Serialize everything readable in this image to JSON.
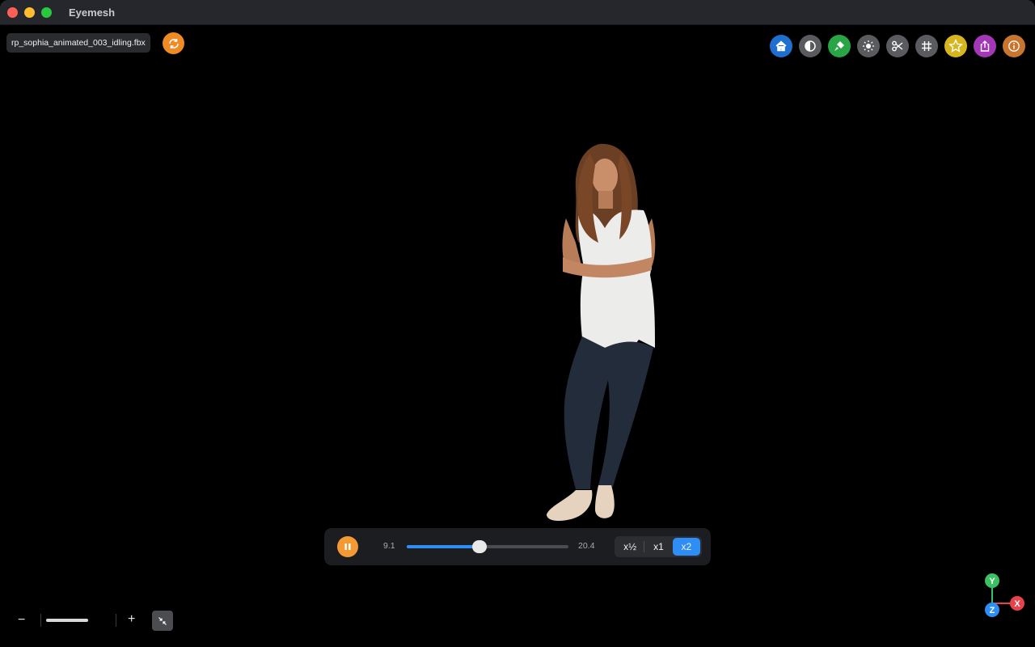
{
  "window": {
    "title": "Eyemesh"
  },
  "file": {
    "name": "rp_sophia_animated_003_idling.fbx"
  },
  "toolbar": {
    "items": [
      {
        "name": "home",
        "icon": "home-icon",
        "color": "#1f6fd1"
      },
      {
        "name": "contrast",
        "icon": "contrast-icon",
        "color": "#5a5b5e"
      },
      {
        "name": "paint",
        "icon": "paint-icon",
        "color": "#2aa545"
      },
      {
        "name": "light",
        "icon": "sun-icon",
        "color": "#5a5b5e"
      },
      {
        "name": "cut",
        "icon": "scissors-icon",
        "color": "#5a5b5e"
      },
      {
        "name": "grid",
        "icon": "grid-icon",
        "color": "#5a5b5e"
      },
      {
        "name": "favorite",
        "icon": "star-icon",
        "color": "#d7b61d"
      },
      {
        "name": "share",
        "icon": "share-icon",
        "color": "#a337b8"
      },
      {
        "name": "info",
        "icon": "info-icon",
        "color": "#c8752f"
      }
    ]
  },
  "player": {
    "current_time": "9.1",
    "total_time": "20.4",
    "progress": 0.45,
    "speeds": [
      "x½",
      "x1",
      "x2"
    ],
    "active_speed": "x2"
  },
  "zoom": {
    "minus": "−",
    "plus": "+",
    "level": 0.5
  },
  "axes": {
    "y": "Y",
    "x": "X",
    "z": "Z"
  }
}
